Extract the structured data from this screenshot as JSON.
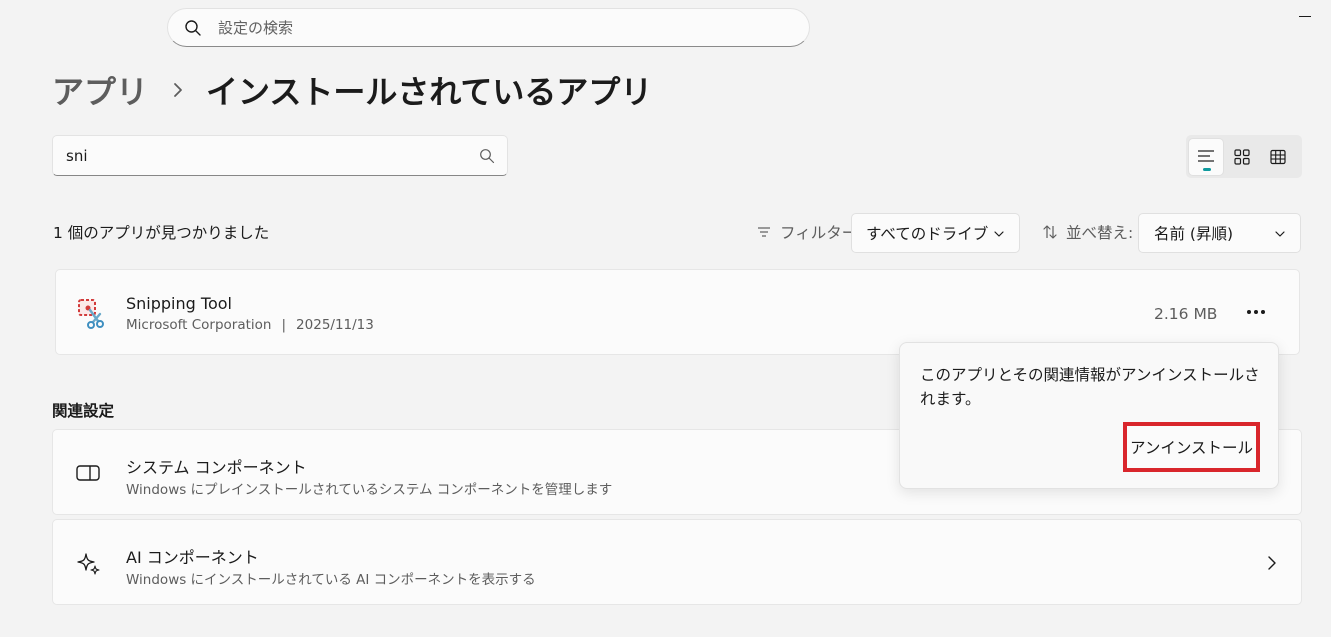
{
  "search": {
    "placeholder": "設定の検索"
  },
  "breadcrumb": {
    "parent": "アプリ",
    "current": "インストールされているアプリ"
  },
  "app_search": {
    "value": "sni"
  },
  "view_options": [
    "list-view-icon",
    "grid-view-icon",
    "table-view-icon"
  ],
  "results": {
    "count_text": "1 個のアプリが見つかりました",
    "filter_label": "フィルター:",
    "filter_value": "すべてのドライブ",
    "sort_label": "並べ替え:",
    "sort_value": "名前 (昇順)"
  },
  "app": {
    "name": "Snipping Tool",
    "publisher": "Microsoft Corporation",
    "separator": "|",
    "date": "2025/11/13",
    "size": "2.16 MB"
  },
  "related": {
    "heading": "関連設定",
    "items": [
      {
        "title": "システム コンポーネント",
        "description": "Windows にプレインストールされているシステム コンポーネントを管理します",
        "icon": "system-component-icon"
      },
      {
        "title": "AI コンポーネント",
        "description": "Windows にインストールされている AI コンポーネントを表示する",
        "icon": "sparkle-icon"
      }
    ]
  },
  "flyout": {
    "message": "このアプリとその関連情報がアンインストールされます。",
    "button_label": "アンインストール"
  },
  "colors": {
    "accent": "#0f9a9e",
    "highlight_border": "#d9262c",
    "background": "#f3f3f3"
  }
}
